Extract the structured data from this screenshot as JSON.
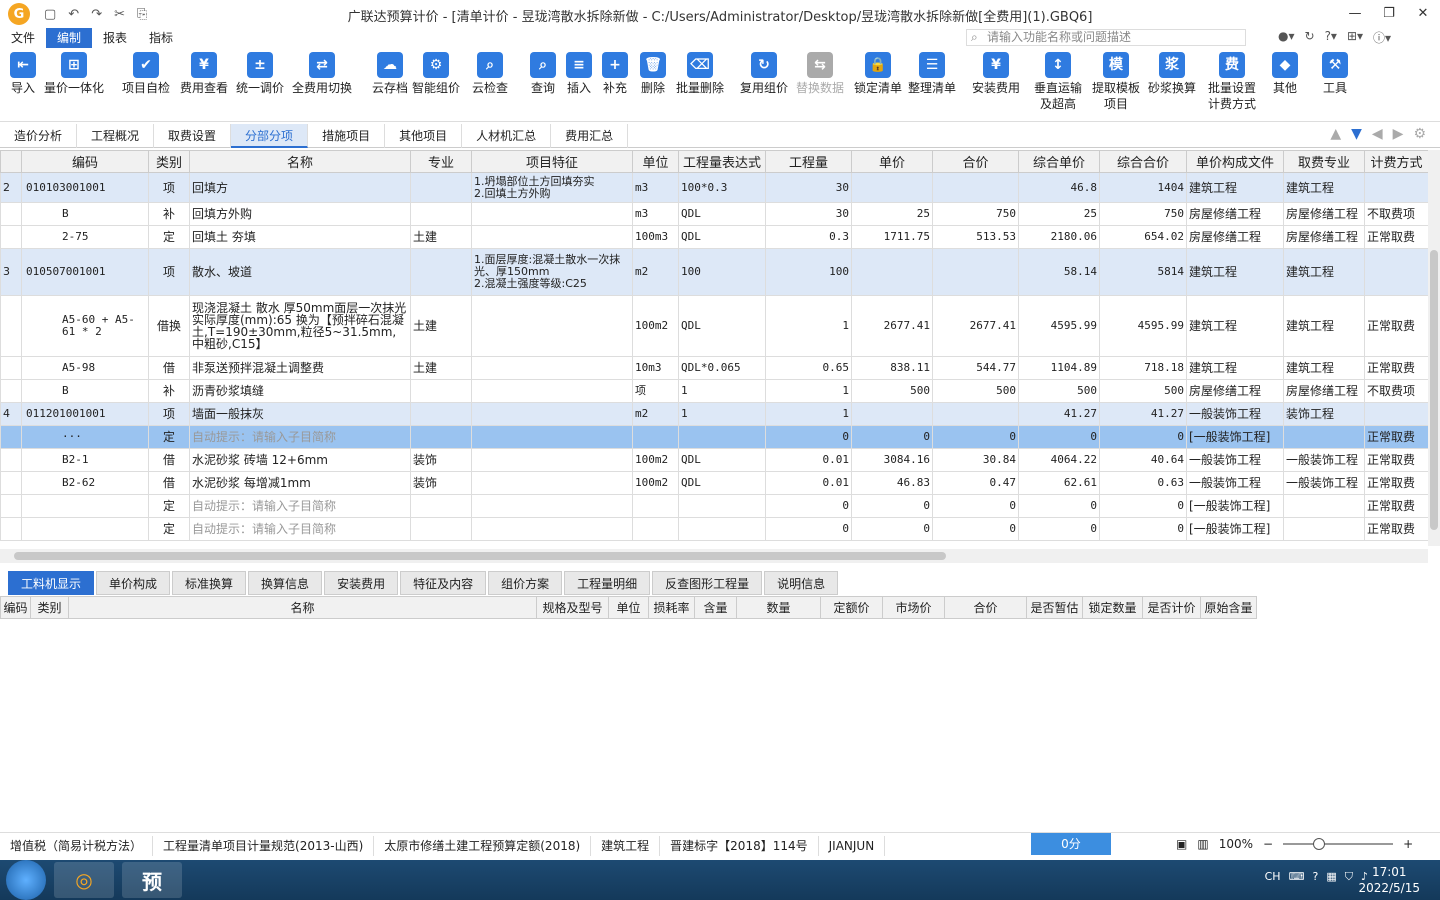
{
  "app": {
    "title": "广联达预算计价 - [清单计价 - 昱珑湾散水拆除新做 - C:/Users/Administrator/Desktop/昱珑湾散水拆除新做[全费用](1).GBQ6]",
    "logo_text": "G"
  },
  "window": {
    "minimize": "—",
    "restore": "❐",
    "close": "✕"
  },
  "quickaccess": [
    "▢",
    "↶",
    "↷",
    "✂",
    "⎘"
  ],
  "menu": [
    "文件",
    "编制",
    "报表",
    "指标"
  ],
  "search": {
    "placeholder": "请输入功能名称或问题描述"
  },
  "toolbar": [
    {
      "label": "导入",
      "glyph": "⇤"
    },
    {
      "label": "量价一体化",
      "glyph": "⊞"
    },
    {
      "label": "项目自检",
      "glyph": "✔"
    },
    {
      "label": "费用查看",
      "glyph": "¥"
    },
    {
      "label": "统一调价",
      "glyph": "±"
    },
    {
      "label": "全费用切换",
      "glyph": "⇄"
    },
    {
      "label": "云存档",
      "glyph": "☁"
    },
    {
      "label": "智能组价",
      "glyph": "⚙"
    },
    {
      "label": "云检查",
      "glyph": "⌕"
    },
    {
      "label": "查询",
      "glyph": "⌕"
    },
    {
      "label": "插入",
      "glyph": "≡"
    },
    {
      "label": "补充",
      "glyph": "+"
    },
    {
      "label": "删除",
      "glyph": "🗑"
    },
    {
      "label": "批量删除",
      "glyph": "⌫"
    },
    {
      "label": "复用组价",
      "glyph": "↻"
    },
    {
      "label": "替换数据",
      "glyph": "⇆"
    },
    {
      "label": "锁定清单",
      "glyph": "🔒"
    },
    {
      "label": "整理清单",
      "glyph": "☰"
    },
    {
      "label": "安装费用",
      "glyph": "¥"
    },
    {
      "label": "垂直运输及超高",
      "glyph": "↕"
    },
    {
      "label": "提取模板项目",
      "glyph": "模"
    },
    {
      "label": "砂浆换算",
      "glyph": "浆"
    },
    {
      "label": "批量设置计费方式",
      "glyph": "费"
    },
    {
      "label": "其他",
      "glyph": "◆"
    },
    {
      "label": "工具",
      "glyph": "⚒"
    }
  ],
  "tabs": [
    "造价分析",
    "工程概况",
    "取费设置",
    "分部分项",
    "措施项目",
    "其他项目",
    "人材机汇总",
    "费用汇总"
  ],
  "grid": {
    "columns": [
      "编码",
      "类别",
      "名称",
      "专业",
      "项目特征",
      "单位",
      "工程量表达式",
      "工程量",
      "单价",
      "合价",
      "综合单价",
      "综合合价",
      "单价构成文件",
      "取费专业",
      "计费方式"
    ],
    "rows": [
      {
        "no": "2",
        "code": "010103001001",
        "cat": "项",
        "name": "回填方",
        "major": "",
        "feat": "1.坍塌部位土方回填夯实\n2.回填土方外购",
        "unit": "m3",
        "expr": "100*0.3",
        "qty": "30",
        "price": "",
        "total": "",
        "cprice": "46.8",
        "ctotal": "1404",
        "file": "建筑工程",
        "fee": "建筑工程",
        "mode": "",
        "type": "item",
        "h": 30
      },
      {
        "no": "",
        "code": "B",
        "cat": "补",
        "name": "回填方外购",
        "major": "",
        "feat": "",
        "unit": "m3",
        "expr": "QDL",
        "qty": "30",
        "price": "25",
        "total": "750",
        "cprice": "25",
        "ctotal": "750",
        "file": "房屋修缮工程",
        "fee": "房屋修缮工程",
        "mode": "不取费项",
        "type": "sub",
        "h": 23
      },
      {
        "no": "",
        "code": "2-75",
        "cat": "定",
        "name": "回填土 夯填",
        "major": "土建",
        "feat": "",
        "unit": "100m3",
        "expr": "QDL",
        "qty": "0.3",
        "price": "1711.75",
        "total": "513.53",
        "cprice": "2180.06",
        "ctotal": "654.02",
        "file": "房屋修缮工程",
        "fee": "房屋修缮工程",
        "mode": "正常取费",
        "type": "sub",
        "h": 23
      },
      {
        "no": "3",
        "code": "010507001001",
        "cat": "项",
        "name": "散水、坡道",
        "major": "",
        "feat": "1.面层厚度:混凝土散水一次抹光、厚150mm\n2.混凝土强度等级:C25",
        "unit": "m2",
        "expr": "100",
        "qty": "100",
        "price": "",
        "total": "",
        "cprice": "58.14",
        "ctotal": "5814",
        "file": "建筑工程",
        "fee": "建筑工程",
        "mode": "",
        "type": "item",
        "h": 47
      },
      {
        "no": "",
        "code": "A5-60 + A5-61 * 2",
        "cat": "借换",
        "name": "现浇混凝土 散水 厚50mm面层一次抹光 实际厚度(mm):65  换为【预拌碎石混凝土,T=190±30mm,粒径5~31.5mm,中粗砂,C15】",
        "major": "土建",
        "feat": "",
        "unit": "100m2",
        "expr": "QDL",
        "qty": "1",
        "price": "2677.41",
        "total": "2677.41",
        "cprice": "4595.99",
        "ctotal": "4595.99",
        "file": "建筑工程",
        "fee": "建筑工程",
        "mode": "正常取费",
        "type": "sub",
        "h": 61
      },
      {
        "no": "",
        "code": "A5-98",
        "cat": "借",
        "name": "非泵送预拌混凝土调整费",
        "major": "土建",
        "feat": "",
        "unit": "10m3",
        "expr": "QDL*0.065",
        "qty": "0.65",
        "price": "838.11",
        "total": "544.77",
        "cprice": "1104.89",
        "ctotal": "718.18",
        "file": "建筑工程",
        "fee": "建筑工程",
        "mode": "正常取费",
        "type": "sub",
        "h": 23
      },
      {
        "no": "",
        "code": "B",
        "cat": "补",
        "name": "沥青砂浆填缝",
        "major": "",
        "feat": "",
        "unit": "项",
        "expr": "1",
        "qty": "1",
        "price": "500",
        "total": "500",
        "cprice": "500",
        "ctotal": "500",
        "file": "房屋修缮工程",
        "fee": "房屋修缮工程",
        "mode": "不取费项",
        "type": "sub",
        "h": 23
      },
      {
        "no": "4",
        "code": "011201001001",
        "cat": "项",
        "name": "墙面一般抹灰",
        "major": "",
        "feat": "",
        "unit": "m2",
        "expr": "1",
        "qty": "1",
        "price": "",
        "total": "",
        "cprice": "41.27",
        "ctotal": "41.27",
        "file": "一般装饰工程",
        "fee": "装饰工程",
        "mode": "",
        "type": "item",
        "h": 23
      },
      {
        "no": "",
        "code": "···",
        "cat": "定",
        "name": "自动提示：请输入子目简称",
        "major": "",
        "feat": "",
        "unit": "",
        "expr": "",
        "qty": "0",
        "price": "0",
        "total": "0",
        "cprice": "0",
        "ctotal": "0",
        "file": "[一般装饰工程]",
        "fee": "",
        "mode": "正常取费",
        "type": "sel",
        "h": 23
      },
      {
        "no": "",
        "code": "B2-1",
        "cat": "借",
        "name": "水泥砂浆 砖墙 12+6mm",
        "major": "装饰",
        "feat": "",
        "unit": "100m2",
        "expr": "QDL",
        "qty": "0.01",
        "price": "3084.16",
        "total": "30.84",
        "cprice": "4064.22",
        "ctotal": "40.64",
        "file": "一般装饰工程",
        "fee": "一般装饰工程",
        "mode": "正常取费",
        "type": "sub",
        "h": 23
      },
      {
        "no": "",
        "code": "B2-62",
        "cat": "借",
        "name": "水泥砂浆 每增减1mm",
        "major": "装饰",
        "feat": "",
        "unit": "100m2",
        "expr": "QDL",
        "qty": "0.01",
        "price": "46.83",
        "total": "0.47",
        "cprice": "62.61",
        "ctotal": "0.63",
        "file": "一般装饰工程",
        "fee": "一般装饰工程",
        "mode": "正常取费",
        "type": "sub",
        "h": 23
      },
      {
        "no": "",
        "code": "",
        "cat": "定",
        "name": "自动提示：请输入子目简称",
        "major": "",
        "feat": "",
        "unit": "",
        "expr": "",
        "qty": "0",
        "price": "0",
        "total": "0",
        "cprice": "0",
        "ctotal": "0",
        "file": "[一般装饰工程]",
        "fee": "",
        "mode": "正常取费",
        "type": "hint",
        "h": 23
      },
      {
        "no": "",
        "code": "",
        "cat": "定",
        "name": "自动提示：请输入子目简称",
        "major": "",
        "feat": "",
        "unit": "",
        "expr": "",
        "qty": "0",
        "price": "0",
        "total": "0",
        "cprice": "0",
        "ctotal": "0",
        "file": "[一般装饰工程]",
        "fee": "",
        "mode": "正常取费",
        "type": "hint",
        "h": 23
      }
    ]
  },
  "bottom_tabs": [
    "工料机显示",
    "单价构成",
    "标准换算",
    "换算信息",
    "安装费用",
    "特征及内容",
    "组价方案",
    "工程量明细",
    "反查图形工程量",
    "说明信息"
  ],
  "bottom_columns": [
    "编码",
    "类别",
    "名称",
    "规格及型号",
    "单位",
    "损耗率",
    "含量",
    "数量",
    "定额价",
    "市场价",
    "合价",
    "是否暂估",
    "锁定数量",
    "是否计价",
    "原始含量"
  ],
  "status": [
    "增值税（简易计税方法）",
    "工程量清单项目计量规范(2013-山西)",
    "太原市修缮土建工程预算定额(2018)",
    "建筑工程",
    "晋建标字【2018】114号",
    "JIANJUN"
  ],
  "score": "0分",
  "zoom": "100%",
  "taskbar": {
    "app": "预",
    "time": "17:01",
    "date": "2022/5/15",
    "lang": "CH"
  }
}
